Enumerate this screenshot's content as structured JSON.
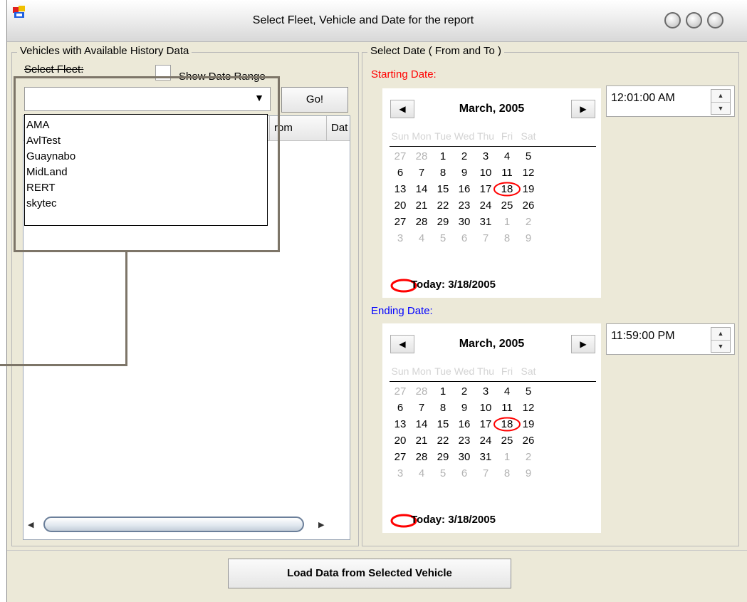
{
  "window": {
    "title": "Select Fleet, Vehicle and Date for the report"
  },
  "vehicles_group": {
    "legend": "Vehicles with Available History Data",
    "select_fleet_label": "Select Fleet:",
    "show_date_range_label": "Show Date Range",
    "go_button": "Go!",
    "fleet_options": [
      "AMA",
      "AvlTest",
      "Guaynabo",
      "MidLand",
      "RERT",
      "skytec"
    ],
    "columns": [
      "rom",
      "Dat"
    ]
  },
  "date_group": {
    "legend": "Select Date ( From and To )",
    "starting_label": "Starting Date:",
    "ending_label": "Ending Date:",
    "start_time": "12:01:00 AM",
    "end_time": "11:59:00 PM",
    "colors": {
      "starting": "#ff0000",
      "ending": "#0000ff",
      "circle": "#ff0000"
    }
  },
  "calendar": {
    "month_title": "March, 2005",
    "day_names": [
      "Sun",
      "Mon",
      "Tue",
      "Wed",
      "Thu",
      "Fri",
      "Sat"
    ],
    "weeks": [
      [
        "27",
        "28",
        "1",
        "2",
        "3",
        "4",
        "5"
      ],
      [
        "6",
        "7",
        "8",
        "9",
        "10",
        "11",
        "12"
      ],
      [
        "13",
        "14",
        "15",
        "16",
        "17",
        "18",
        "19"
      ],
      [
        "20",
        "21",
        "22",
        "23",
        "24",
        "25",
        "26"
      ],
      [
        "27",
        "28",
        "29",
        "30",
        "31",
        "1",
        "2"
      ],
      [
        "3",
        "4",
        "5",
        "6",
        "7",
        "8",
        "9"
      ]
    ],
    "selected_day": "18",
    "today_text": "Today: 3/18/2005"
  },
  "footer": {
    "load_button": "Load Data from Selected Vehicle"
  }
}
